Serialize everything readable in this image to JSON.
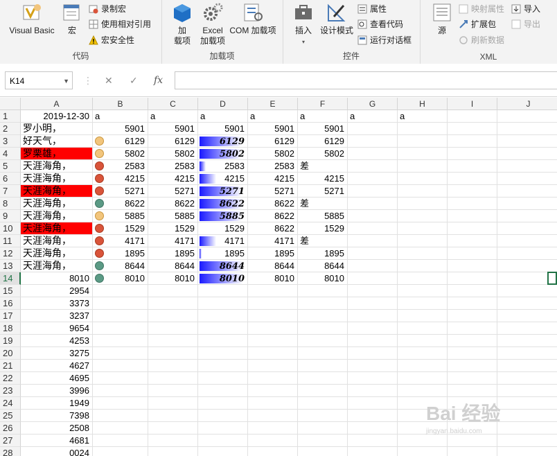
{
  "ribbon": {
    "groups": {
      "code": "代码",
      "addins": "加载项",
      "controls": "控件",
      "xml": "XML"
    },
    "visual_basic": "Visual Basic",
    "macros": "宏",
    "record_macro": "录制宏",
    "use_relative": "使用相对引用",
    "macro_security": "宏安全性",
    "addins_btn": "加\n载项",
    "addins_l1": "加",
    "addins_l2": "载项",
    "excel_addins_l1": "Excel",
    "excel_addins_l2": "加载项",
    "com_addins": "COM 加载项",
    "insert": "插入",
    "design_mode": "设计模式",
    "properties": "属性",
    "view_code": "查看代码",
    "run_dialog": "运行对话框",
    "source": "源",
    "map_properties": "映射属性",
    "expansion_packs": "扩展包",
    "refresh_data": "刷新数据",
    "import": "导入",
    "export": "导出"
  },
  "formula_bar": {
    "name_box": "K14",
    "cancel": "✕",
    "enter": "✓",
    "fx": "fx",
    "value": ""
  },
  "columns": [
    "A",
    "B",
    "C",
    "D",
    "E",
    "F",
    "G",
    "H",
    "I",
    "J"
  ],
  "rows": [
    {
      "n": "1",
      "A": "2019-12-30",
      "Apos": "right",
      "B": "a",
      "C": "a",
      "D": "a",
      "E": "a",
      "F": "a",
      "G": "a",
      "H": "a",
      "dot": "",
      "dbar": 0
    },
    {
      "n": "2",
      "A": "罗小明，",
      "B": "5901",
      "C": "5901",
      "D": "5901",
      "E": "5901",
      "F": "5901",
      "dot": "",
      "dbar": 0
    },
    {
      "n": "3",
      "A": "好天气，",
      "B": "6129",
      "C": "6129",
      "D": "6129",
      "E": "6129",
      "F": "6129",
      "dot": "yellow",
      "dbar": 0.93
    },
    {
      "n": "4",
      "A": "罗栗雄，",
      "red": true,
      "B": "5802",
      "C": "5802",
      "D": "5802",
      "E": "5802",
      "F": "5802",
      "dot": "yellow",
      "dbar": 0.93
    },
    {
      "n": "5",
      "A": "天涯海角，",
      "B": "2583",
      "C": "2583",
      "D": "2583",
      "E": "2583",
      "F": "差",
      "dot": "red",
      "dbar": 0.14
    },
    {
      "n": "6",
      "A": "天涯海角，",
      "B": "4215",
      "C": "4215",
      "D": "4215",
      "E": "4215",
      "F": "4215",
      "dot": "red",
      "dbar": 0.37
    },
    {
      "n": "7",
      "A": "天涯海角，",
      "red": true,
      "B": "5271",
      "C": "5271",
      "D": "5271",
      "E": "5271",
      "F": "5271",
      "dot": "red",
      "dbar": 0.93
    },
    {
      "n": "8",
      "A": "天涯海角，",
      "B": "8622",
      "C": "8622",
      "D": "8622",
      "E": "8622",
      "F": "差",
      "dot": "green",
      "dbar": 0.96
    },
    {
      "n": "9",
      "A": "天涯海角，",
      "B": "5885",
      "C": "5885",
      "D": "5885",
      "E": "8622",
      "F": "5885",
      "dot": "yellow",
      "dbar": 0.93
    },
    {
      "n": "10",
      "A": "天涯海角，",
      "red": true,
      "B": "1529",
      "C": "1529",
      "D": "1529",
      "E": "8622",
      "F": "1529",
      "dot": "red",
      "dbar": 0.0
    },
    {
      "n": "11",
      "A": "天涯海角，",
      "B": "4171",
      "C": "4171",
      "D": "4171",
      "E": "4171",
      "F": "差",
      "dot": "red",
      "dbar": 0.37
    },
    {
      "n": "12",
      "A": "天涯海角，",
      "B": "1895",
      "C": "1895",
      "D": "1895",
      "E": "1895",
      "F": "1895",
      "dot": "red",
      "dbar": 0.05
    },
    {
      "n": "13",
      "A": "天涯海角，",
      "B": "8644",
      "C": "8644",
      "D": "8644",
      "E": "8644",
      "F": "8644",
      "dot": "green",
      "dbar": 0.96
    },
    {
      "n": "14",
      "A": "8010",
      "Apos": "right",
      "B": "8010",
      "C": "8010",
      "D": "8010",
      "E": "8010",
      "F": "8010",
      "dot": "green",
      "dbar": 0.96
    },
    {
      "n": "15",
      "A": "2954",
      "Apos": "right"
    },
    {
      "n": "16",
      "A": "3373",
      "Apos": "right"
    },
    {
      "n": "17",
      "A": "3237",
      "Apos": "right"
    },
    {
      "n": "18",
      "A": "9654",
      "Apos": "right"
    },
    {
      "n": "19",
      "A": "4253",
      "Apos": "right"
    },
    {
      "n": "20",
      "A": "3275",
      "Apos": "right"
    },
    {
      "n": "21",
      "A": "4627",
      "Apos": "right"
    },
    {
      "n": "22",
      "A": "4695",
      "Apos": "right"
    },
    {
      "n": "23",
      "A": "3996",
      "Apos": "right"
    },
    {
      "n": "24",
      "A": "1949",
      "Apos": "right"
    },
    {
      "n": "25",
      "A": "7398",
      "Apos": "right"
    },
    {
      "n": "26",
      "A": "2508",
      "Apos": "right"
    },
    {
      "n": "27",
      "A": "4681",
      "Apos": "right"
    },
    {
      "n": "28",
      "A": "0024",
      "Apos": "right"
    }
  ],
  "bold_italic_D_rows": [
    "3",
    "4",
    "7",
    "8",
    "9",
    "13",
    "14"
  ],
  "colors": {
    "accent": "#217346",
    "red_fill": "#ff0000",
    "dot_yellow": "#f2c57c",
    "dot_red": "#d9543a",
    "dot_green": "#5b9a85",
    "bar": "#1a1aff"
  },
  "watermark": {
    "main": "Bai 经验",
    "sub": "jingyan.baidu.com"
  }
}
